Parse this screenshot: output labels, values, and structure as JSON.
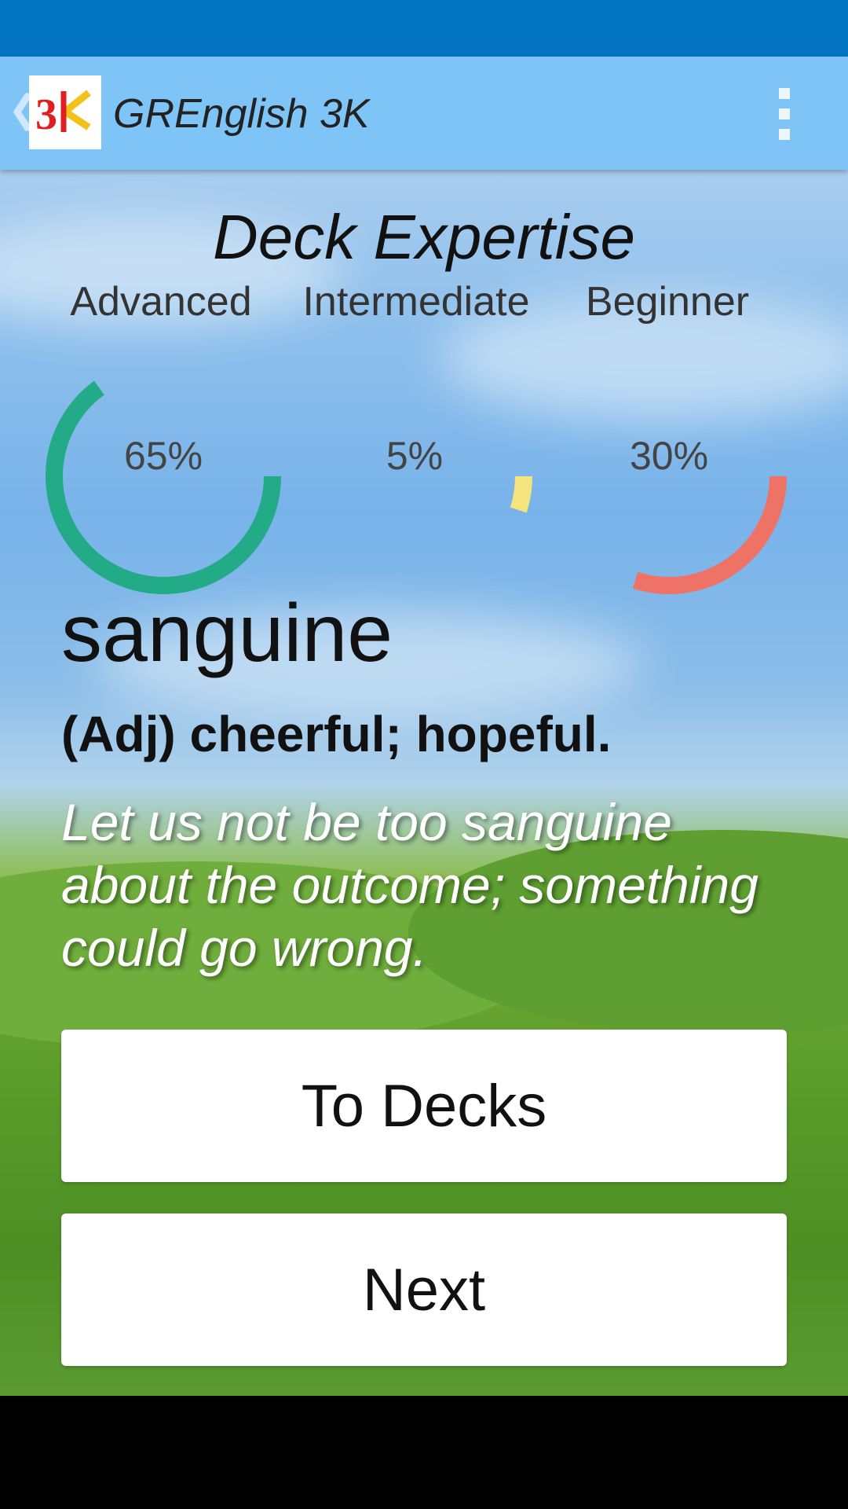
{
  "app_bar": {
    "title": "GREnglish 3K",
    "back_icon": "chevron-left-icon",
    "menu_icon": "overflow-menu-icon",
    "logo_text": "3K",
    "colors": {
      "status_bar": "#0274c0",
      "app_bar": "#7fc4f6"
    }
  },
  "expertise": {
    "title": "Deck Expertise",
    "levels": [
      {
        "label": "Advanced",
        "percent_text": "65%",
        "value": 0.65,
        "color": "#22ab86"
      },
      {
        "label": "Intermediate",
        "percent_text": "5%",
        "value": 0.05,
        "color": "#f5e47e"
      },
      {
        "label": "Beginner",
        "percent_text": "30%",
        "value": 0.3,
        "color": "#ee7366"
      }
    ]
  },
  "card": {
    "word": "sanguine",
    "definition": "(Adj) cheerful; hopeful.",
    "example": "Let us not be too sanguine about the outcome; something could go wrong."
  },
  "buttons": {
    "to_decks": "To Decks",
    "next": "Next"
  }
}
